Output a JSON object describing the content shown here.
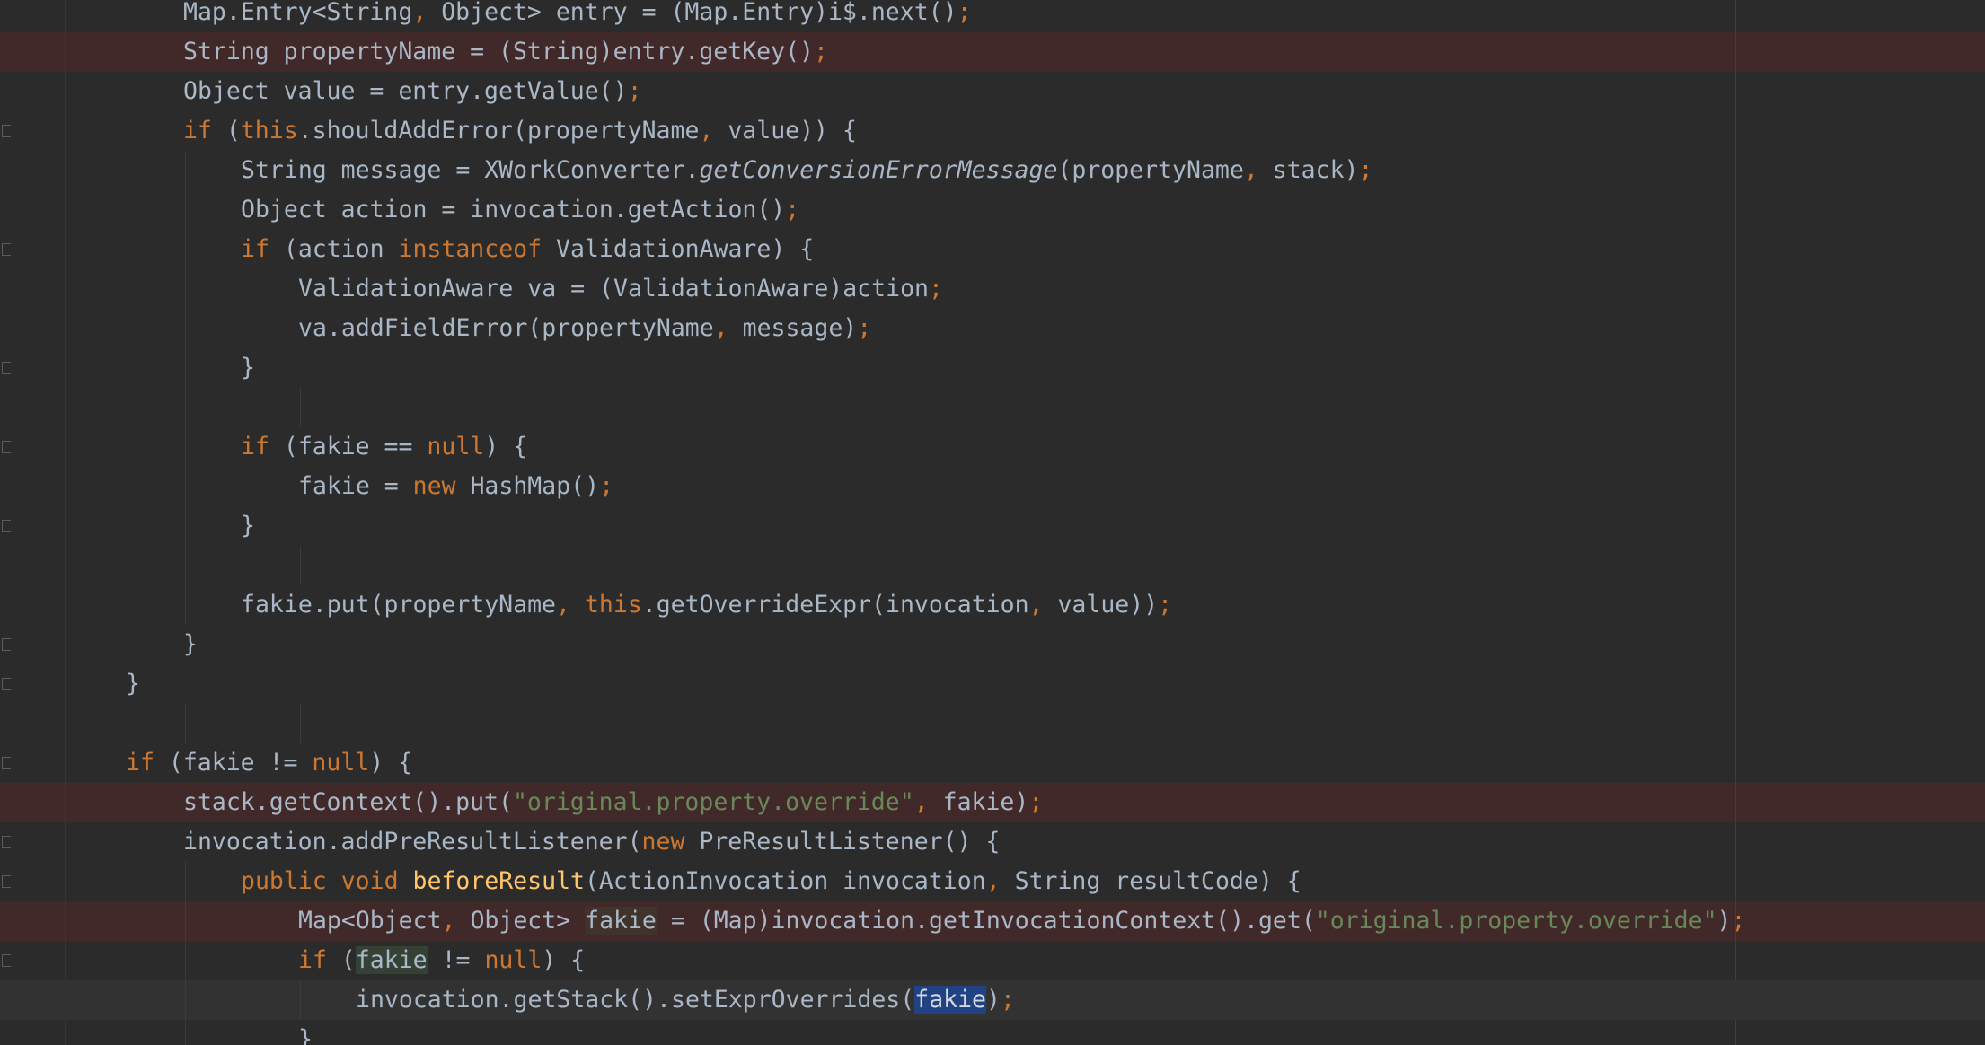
{
  "editor": {
    "lines": [
      {
        "indent": 2,
        "bg": "",
        "tokens": [
          [
            "Map.Entry<String",
            "pl"
          ],
          [
            ",",
            "kw"
          ],
          [
            " Object> entry = (Map.Entry)i$.next()",
            "pl"
          ],
          [
            ";",
            "kw"
          ]
        ]
      },
      {
        "indent": 2,
        "bg": "bp",
        "tokens": [
          [
            "String propertyName = (String)entry.getKey()",
            "pl"
          ],
          [
            ";",
            "kw"
          ]
        ]
      },
      {
        "indent": 2,
        "bg": "",
        "tokens": [
          [
            "Object value = entry.getValue()",
            "pl"
          ],
          [
            ";",
            "kw"
          ]
        ]
      },
      {
        "indent": 2,
        "bg": "",
        "fold": true,
        "tokens": [
          [
            "if",
            "kw"
          ],
          [
            " (",
            "pl"
          ],
          [
            "this",
            "kw"
          ],
          [
            ".shouldAddError(propertyName",
            "pl"
          ],
          [
            ",",
            "kw"
          ],
          [
            " value)) {",
            "pl"
          ]
        ]
      },
      {
        "indent": 3,
        "bg": "",
        "tokens": [
          [
            "String message = XWorkConverter.",
            "pl"
          ],
          [
            "getConversionErrorMessage",
            "pl it"
          ],
          [
            "(propertyName",
            "pl"
          ],
          [
            ",",
            "kw"
          ],
          [
            " stack)",
            "pl"
          ],
          [
            ";",
            "kw"
          ]
        ]
      },
      {
        "indent": 3,
        "bg": "",
        "tokens": [
          [
            "Object action = invocation.getAction()",
            "pl"
          ],
          [
            ";",
            "kw"
          ]
        ]
      },
      {
        "indent": 3,
        "bg": "",
        "fold": true,
        "tokens": [
          [
            "if",
            "kw"
          ],
          [
            " (action ",
            "pl"
          ],
          [
            "instanceof",
            "kw"
          ],
          [
            " ValidationAware) {",
            "pl"
          ]
        ]
      },
      {
        "indent": 4,
        "bg": "",
        "tokens": [
          [
            "ValidationAware va = (ValidationAware)action",
            "pl"
          ],
          [
            ";",
            "kw"
          ]
        ]
      },
      {
        "indent": 4,
        "bg": "",
        "tokens": [
          [
            "va.addFieldError(propertyName",
            "pl"
          ],
          [
            ",",
            "kw"
          ],
          [
            " message)",
            "pl"
          ],
          [
            ";",
            "kw"
          ]
        ]
      },
      {
        "indent": 3,
        "bg": "",
        "fold": true,
        "tokens": [
          [
            "}",
            "pl"
          ]
        ]
      },
      {
        "indent": 3,
        "bg": "",
        "tokens": []
      },
      {
        "indent": 3,
        "bg": "",
        "fold": true,
        "tokens": [
          [
            "if",
            "kw"
          ],
          [
            " (fakie == ",
            "pl"
          ],
          [
            "null",
            "kw"
          ],
          [
            ") {",
            "pl"
          ]
        ]
      },
      {
        "indent": 4,
        "bg": "",
        "tokens": [
          [
            "fakie = ",
            "pl"
          ],
          [
            "new",
            "kw"
          ],
          [
            " HashMap()",
            "pl"
          ],
          [
            ";",
            "kw"
          ]
        ]
      },
      {
        "indent": 3,
        "bg": "",
        "fold": true,
        "tokens": [
          [
            "}",
            "pl"
          ]
        ]
      },
      {
        "indent": 3,
        "bg": "",
        "tokens": []
      },
      {
        "indent": 3,
        "bg": "",
        "tokens": [
          [
            "fakie.put(propertyName",
            "pl"
          ],
          [
            ",",
            "kw"
          ],
          [
            " ",
            "pl"
          ],
          [
            "this",
            "kw"
          ],
          [
            ".getOverrideExpr(invocation",
            "pl"
          ],
          [
            ",",
            "kw"
          ],
          [
            " value))",
            "pl"
          ],
          [
            ";",
            "kw"
          ]
        ]
      },
      {
        "indent": 2,
        "bg": "",
        "fold": true,
        "tokens": [
          [
            "}",
            "pl"
          ]
        ]
      },
      {
        "indent": 1,
        "bg": "",
        "fold": true,
        "tokens": [
          [
            "}",
            "pl"
          ]
        ]
      },
      {
        "indent": 1,
        "bg": "",
        "tokens": []
      },
      {
        "indent": 1,
        "bg": "",
        "fold": true,
        "tokens": [
          [
            "if",
            "kw"
          ],
          [
            " (fakie != ",
            "pl"
          ],
          [
            "null",
            "kw"
          ],
          [
            ") {",
            "pl"
          ]
        ]
      },
      {
        "indent": 2,
        "bg": "bp",
        "tokens": [
          [
            "stack.getContext().put(",
            "pl"
          ],
          [
            "\"original.property.override\"",
            "str"
          ],
          [
            ",",
            "kw"
          ],
          [
            " fakie)",
            "pl"
          ],
          [
            ";",
            "kw"
          ]
        ]
      },
      {
        "indent": 2,
        "bg": "",
        "fold": true,
        "tokens": [
          [
            "invocation.addPreResultListener(",
            "pl"
          ],
          [
            "new",
            "kw"
          ],
          [
            " PreResultListener() {",
            "pl"
          ]
        ]
      },
      {
        "indent": 3,
        "bg": "",
        "fold": true,
        "tokens": [
          [
            "public",
            "kw"
          ],
          [
            " ",
            "pl"
          ],
          [
            "void",
            "kw"
          ],
          [
            " ",
            "pl"
          ],
          [
            "beforeResult",
            "fn"
          ],
          [
            "(ActionInvocation invocation",
            "pl"
          ],
          [
            ",",
            "kw"
          ],
          [
            " String resultCode) {",
            "pl"
          ]
        ]
      },
      {
        "indent": 4,
        "bg": "bp",
        "tokens": [
          [
            "Map<Object",
            "pl"
          ],
          [
            ",",
            "kw"
          ],
          [
            " Object> ",
            "pl"
          ],
          [
            "fakie",
            "pl hl-decl"
          ],
          [
            " = (Map)invocation.getInvocationContext().get(",
            "pl"
          ],
          [
            "\"original.property.override\"",
            "str"
          ],
          [
            ")",
            "pl"
          ],
          [
            ";",
            "kw"
          ]
        ]
      },
      {
        "indent": 4,
        "bg": "",
        "fold": true,
        "tokens": [
          [
            "if",
            "kw"
          ],
          [
            " (",
            "pl"
          ],
          [
            "fakie",
            "pl hl-read"
          ],
          [
            " != ",
            "pl"
          ],
          [
            "null",
            "kw"
          ],
          [
            ") {",
            "pl"
          ]
        ]
      },
      {
        "indent": 5,
        "bg": "caret",
        "tokens": [
          [
            "invocation.getStack().setExprOverrides(",
            "pl"
          ],
          [
            "fakie",
            "pl hl-sel"
          ],
          [
            ")",
            "pl"
          ],
          [
            ";",
            "kw"
          ]
        ]
      },
      {
        "indent": 4,
        "bg": "",
        "tokens": [
          [
            "}",
            "pl"
          ]
        ]
      }
    ]
  }
}
